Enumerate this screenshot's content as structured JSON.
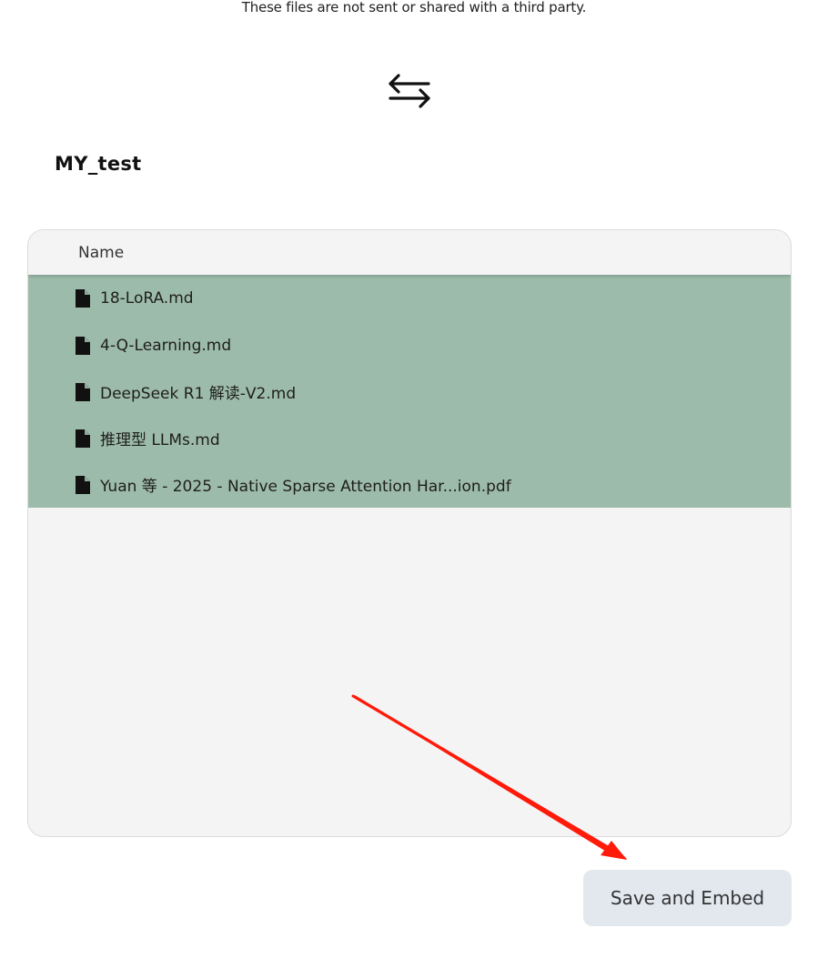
{
  "privacy_note": "These files are not sent or shared with a third party.",
  "swap_icon": "arrows-left-right-icon",
  "folder": {
    "title": "MY_test"
  },
  "table": {
    "header_name": "Name",
    "files": [
      {
        "name": "18-LoRA.md",
        "icon": "file-icon"
      },
      {
        "name": "4-Q-Learning.md",
        "icon": "file-icon"
      },
      {
        "name": "DeepSeek R1 解读-V2.md",
        "icon": "file-icon"
      },
      {
        "name": "推理型 LLMs.md",
        "icon": "file-icon"
      },
      {
        "name": "Yuan 等 - 2025 - Native Sparse Attention Har...ion.pdf",
        "icon": "file-icon"
      }
    ],
    "selected_row_color": "#9dbbaa"
  },
  "actions": {
    "save_label": "Save and Embed"
  },
  "annotation": {
    "arrow_color": "#ff1a0a"
  }
}
